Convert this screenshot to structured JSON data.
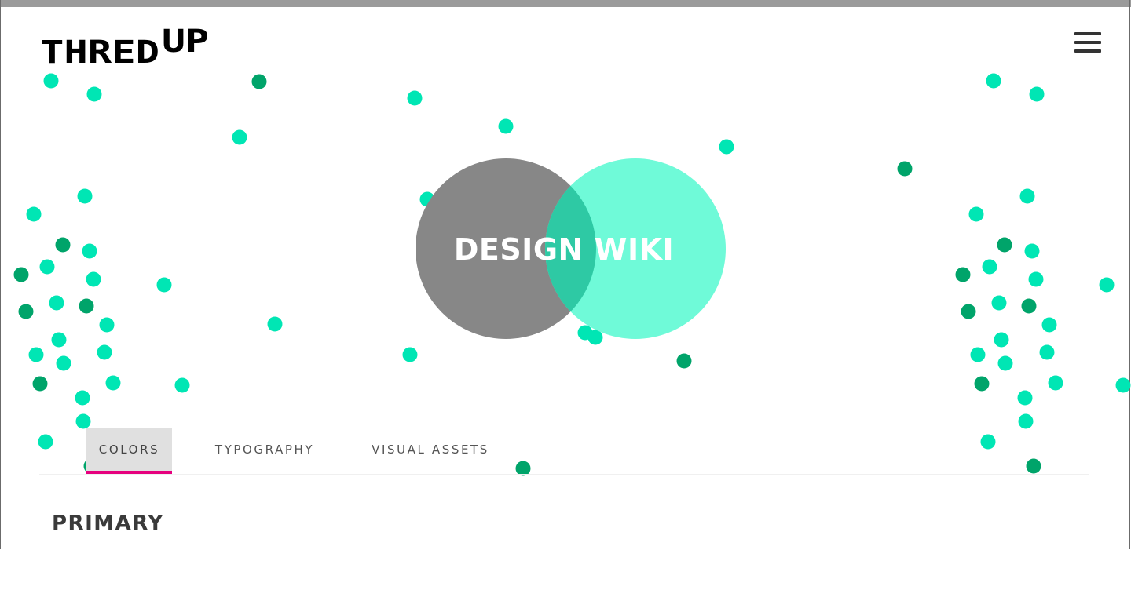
{
  "header": {
    "logo_text_main": "THRED",
    "logo_text_super": "UP",
    "menu_icon": "hamburger-menu-icon"
  },
  "hero": {
    "title": "DESIGN WIKI"
  },
  "tabs": [
    {
      "label": "COLORS",
      "active": true
    },
    {
      "label": "TYPOGRAPHY",
      "active": false
    },
    {
      "label": "VISUAL ASSETS",
      "active": false
    }
  ],
  "section": {
    "title": "PRIMARY"
  },
  "colors": {
    "mint": "#00e6b4",
    "green": "#00a46a",
    "gray_circle": "#777777",
    "mint_circle": "#6ffad8",
    "overlap": "#2ec9a4",
    "active_tab_underline": "#e6007e",
    "active_tab_bg": "#e0e0e0",
    "text_dark": "#3a3a3a"
  }
}
